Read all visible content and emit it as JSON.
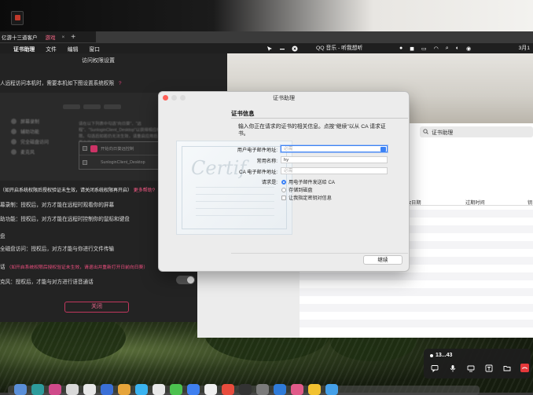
{
  "tabs": {
    "tab1": "亿游十三道客户",
    "tab2": "游戏",
    "close": "×",
    "new_tab": "+"
  },
  "menubar": {
    "apple": "",
    "items": [
      "证书助理",
      "文件",
      "编辑",
      "窗口"
    ],
    "music": "QQ 音乐 - 听我想听",
    "clock": "3月1"
  },
  "dark_window": {
    "title": "访问权限设置",
    "desc": "人远程访问本机时，需要本机如下图设置系统权限",
    "help_icon": "?",
    "mock_sidebar": [
      "屏幕录制",
      "辅助功能",
      "完全磁盘访问",
      "麦克风"
    ],
    "mock_text": "请在以下列表中勾选\"向日葵\"、\"远程\"、\"SunloginClient_Desktop\"以获得相应权限。勾选后如若仍无法生效，请重启应用后再次尝试...",
    "mock_items": [
      "开始向日葵远控制",
      "SunloginClient_Desktop"
    ],
    "rows": [
      {
        "text": "（如开启系统权限后授权验证未生效，请关闭系统权限再开启）",
        "link": "更多帮助?"
      },
      {
        "text": "幕录制：授权后，对方才能在远程时观看你的屏幕"
      },
      {
        "text": "助功能：授权后，对方才能在远程时控制你的鼠标和键盘"
      },
      {
        "text": "盘"
      },
      {
        "text": "全磁盘访问：授权后，对方才能与你进行文件传输"
      },
      {
        "text": "话",
        "note": "（如开启系统权限后授权验证未生效，请退出并重新打开日前向日葵）"
      },
      {
        "text": "克风：授权后，才能与对方进行语音通话"
      }
    ],
    "close_button": "关闭"
  },
  "keychain": {
    "search_placeholder": "证书助理",
    "columns": [
      "改日期",
      "过期时间",
      "钥"
    ]
  },
  "dialog": {
    "title": "证书助理",
    "section_title": "证书信息",
    "instruction": "输入你正在请求的证书的相关信息。点按\"继续\"以从 CA 请求证书。",
    "certificate_art_text": "Certif",
    "fields": [
      {
        "label": "用户电子邮件地址:",
        "value": "",
        "placeholder": "必需"
      },
      {
        "label": "常用名称:",
        "value": "hy",
        "placeholder": ""
      },
      {
        "label": "CA 电子邮件地址:",
        "value": "",
        "placeholder": "必需"
      }
    ],
    "request_label": "请求是:",
    "options": [
      {
        "label": "用电子邮件发送给 CA",
        "selected": true
      },
      {
        "label": "存储到磁盘",
        "selected": false
      }
    ],
    "checkbox_label": "让我指定密钥对信息",
    "continue_button": "继续"
  },
  "call_panel": {
    "title": "13...43",
    "icons": [
      "chat-icon",
      "mic-icon",
      "screen-icon",
      "text-icon",
      "folder-icon",
      "hangup-icon"
    ]
  },
  "colors": {
    "accent_blue": "#3b82f6",
    "pink": "#f14f80",
    "close_red": "#ff5f57"
  }
}
